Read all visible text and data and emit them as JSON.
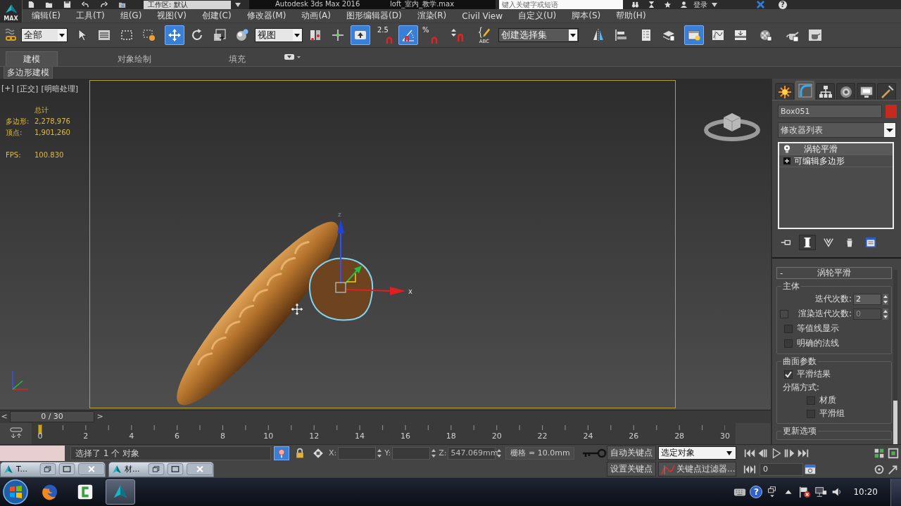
{
  "app_button": {
    "label": "MAX"
  },
  "title_bar": {
    "workspace": "工作区: 默认",
    "title": "Autodesk 3ds Max 2016",
    "file": "loft_室内_教学.max",
    "search": {
      "placeholder": "键入关键字或短语"
    },
    "sign_in": "登录",
    "help": "?"
  },
  "menu": [
    "编辑(E)",
    "工具(T)",
    "组(G)",
    "视图(V)",
    "创建(C)",
    "修改器(M)",
    "动画(A)",
    "图形编辑器(D)",
    "渲染(R)",
    "Civil View",
    "自定义(U)",
    "脚本(S)",
    "帮助(H)"
  ],
  "toolbar": [
    {
      "kind": "button",
      "selected": false
    },
    {
      "kind": "dropdown",
      "value": "全部"
    },
    {
      "kind": "button",
      "selected": false
    },
    {
      "kind": "button",
      "selected": false
    },
    {
      "kind": "button",
      "selected": false
    },
    {
      "kind": "button",
      "selected": false
    },
    {
      "kind": "button",
      "selected": true
    },
    {
      "kind": "button",
      "selected": false
    },
    {
      "kind": "button",
      "selected": false
    },
    {
      "kind": "button",
      "selected": false
    },
    {
      "kind": "dropdown",
      "value": "视图"
    },
    {
      "kind": "button",
      "selected": false
    },
    {
      "kind": "button",
      "selected": false
    },
    {
      "kind": "button",
      "selected": true
    },
    {
      "kind": "button",
      "selected": false,
      "label": "2.5"
    },
    {
      "kind": "button",
      "selected": true
    },
    {
      "kind": "button",
      "selected": false,
      "label": "%"
    },
    {
      "kind": "button",
      "selected": false
    },
    {
      "kind": "button",
      "selected": false,
      "label": "ABC"
    },
    {
      "kind": "dropdown",
      "value": "创建选择集"
    },
    {
      "kind": "button",
      "selected": false
    },
    {
      "kind": "button",
      "selected": false
    },
    {
      "kind": "button",
      "selected": false
    },
    {
      "kind": "button",
      "selected": false
    },
    {
      "kind": "button",
      "selected": true
    },
    {
      "kind": "button",
      "selected": false
    },
    {
      "kind": "button",
      "selected": false
    },
    {
      "kind": "button",
      "selected": false
    },
    {
      "kind": "button",
      "selected": false
    },
    {
      "kind": "button",
      "selected": false
    }
  ],
  "ribbon": {
    "tabs": [
      {
        "label": "建模",
        "selected": true
      },
      {
        "label": "对象绘制",
        "selected": false
      },
      {
        "label": "填充",
        "selected": false
      }
    ],
    "panel_tab": "多边形建模"
  },
  "viewport": {
    "labels": [
      "[+]",
      "[正交]",
      "[明暗处理]"
    ],
    "stats": {
      "header": "总计",
      "rows": [
        {
          "label": "多边形:",
          "value": "2,278,976"
        },
        {
          "label": "顶点:",
          "value": "1,901,260"
        }
      ],
      "fps": {
        "label": "FPS:",
        "value": "100.830"
      }
    },
    "gizmo": {
      "z": "z",
      "x": "x"
    }
  },
  "command_panel": {
    "tabs": [
      {
        "selected": false
      },
      {
        "selected": true
      },
      {
        "selected": false
      },
      {
        "selected": false
      },
      {
        "selected": false
      },
      {
        "selected": false
      }
    ],
    "object": {
      "name": "Box051",
      "color": "#c42a1e"
    },
    "modifier_list": "修改器列表",
    "stack": [
      {
        "kind": "modifier",
        "label": "涡轮平滑",
        "selected": true,
        "on": true
      },
      {
        "kind": "object",
        "label": "可编辑多边形",
        "selected": false,
        "expanded": false
      }
    ],
    "stack_buttons": [
      {
        "selected": false
      },
      {
        "selected": true
      },
      {
        "selected": false
      },
      {
        "selected": false
      },
      {
        "selected": false
      }
    ],
    "rollout": {
      "toggle": "-",
      "title": "涡轮平滑",
      "groups": [
        {
          "title": "主体",
          "rows": [
            {
              "kind": "spinner",
              "label": "迭代次数:",
              "value": "2"
            },
            {
              "kind": "check-spinner",
              "label": "渲染迭代次数:",
              "value": "0",
              "checked": false,
              "disabled": true
            },
            {
              "kind": "checkbox",
              "label": "等值线显示",
              "checked": false
            },
            {
              "kind": "checkbox",
              "label": "明确的法线",
              "checked": false
            }
          ]
        },
        {
          "title": "曲面参数",
          "rows": [
            {
              "kind": "checkbox",
              "label": "平滑结果",
              "checked": true
            },
            {
              "kind": "text",
              "label": "分隔方式:"
            },
            {
              "kind": "subcheckbox",
              "label": "材质",
              "checked": false
            },
            {
              "kind": "subcheckbox",
              "label": "平滑组",
              "checked": false
            }
          ]
        },
        {
          "title": "更新选项"
        }
      ]
    }
  },
  "time_slider": {
    "prev": "<",
    "label": "0 / 30",
    "next": ">",
    "level": 0
  },
  "track_bar": {
    "ticks": [
      "0",
      "2",
      "4",
      "6",
      "8",
      "10",
      "12",
      "14",
      "16",
      "18",
      "20",
      "22",
      "24",
      "26",
      "28",
      "30"
    ]
  },
  "status": {
    "prompt": "选择了 1 个 对象",
    "toggles": [
      {
        "selected": true
      },
      {
        "selected": false
      },
      {
        "selected": false
      }
    ],
    "coords": [
      {
        "label": "X:"
      },
      {
        "label": "Y:"
      },
      {
        "label": "Z:",
        "value": "547.069mm"
      }
    ],
    "grid": "栅格 = 10.0mm",
    "auto_key": {
      "label": "自动关键点",
      "on": false
    },
    "key_target": "选定对象",
    "set_key": "设置关键点",
    "key_filters": "关键点过滤器...",
    "frame": "0"
  },
  "minimized_windows": [
    {
      "title": "T..."
    },
    {
      "title": "材..."
    }
  ],
  "taskbar": {
    "apps": [
      {
        "selected": false
      },
      {
        "selected": false
      },
      {
        "selected": true
      }
    ],
    "help": "?",
    "time": "10:20"
  }
}
